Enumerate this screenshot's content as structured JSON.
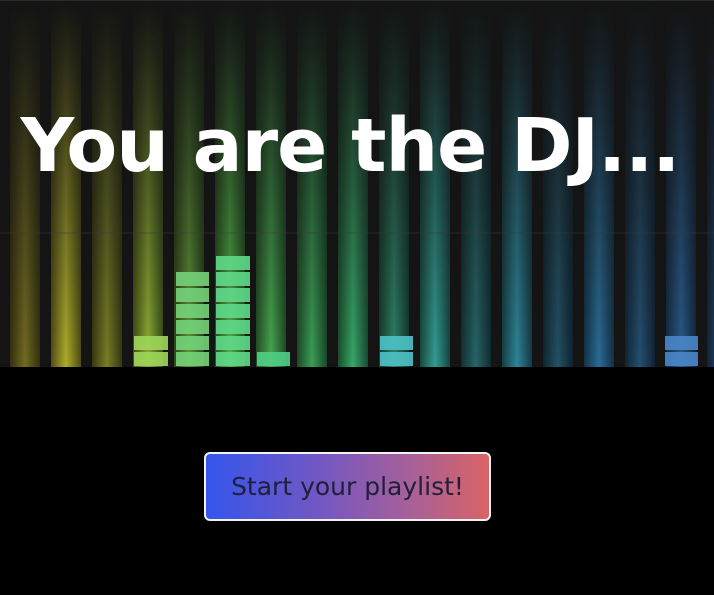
{
  "hero": {
    "headline": "You are the DJ..."
  },
  "cta": {
    "label": "Start your playlist!"
  },
  "colors": {
    "background": "#000000",
    "hero_background": "#141414",
    "headline": "#ffffff",
    "cta_gradient_start": "#3556ec",
    "cta_gradient_end": "#d96465",
    "cta_text": "#1f1f3a"
  }
}
